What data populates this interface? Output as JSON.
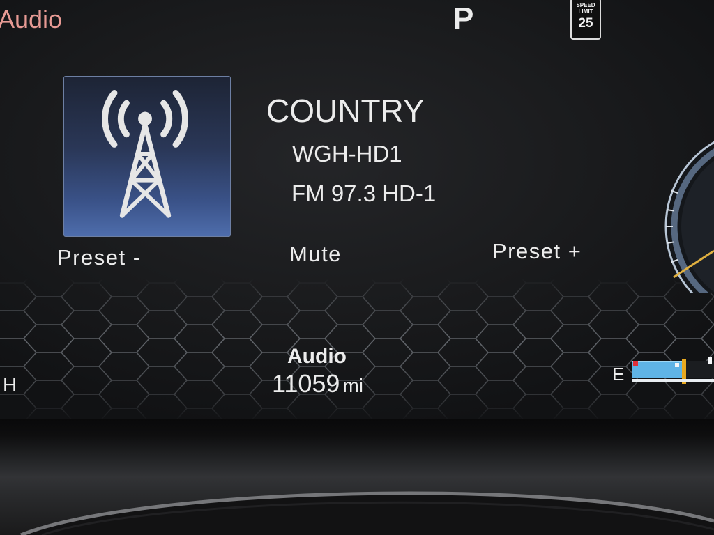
{
  "header": {
    "source_label": "Audio",
    "gear": "P",
    "speed_limit": {
      "line1": "SPEED",
      "line2": "LIMIT",
      "value": "25"
    }
  },
  "now_playing": {
    "icon": "radio-tower-icon",
    "genre": "COUNTRY",
    "station": "WGH-HD1",
    "band_frequency": "FM 97.3 HD-1"
  },
  "controls": [
    {
      "label": "Preset -"
    },
    {
      "label": "Mute"
    },
    {
      "label": "Preset +"
    }
  ],
  "info_panel": {
    "title": "Audio",
    "value": "11059",
    "unit": "mi"
  },
  "temp_gauge": {
    "label": "H"
  },
  "fuel_gauge": {
    "label": "E"
  },
  "icons": {
    "station_art": "radio-tower-icon",
    "speedometer": "speedometer-gauge-icon",
    "fuel": "fuel-level-bar"
  },
  "colors": {
    "text": "#ececec",
    "source": "#e79a94",
    "icon_bg": "#3a5288",
    "fuel": "#5fb4e6",
    "amber": "#e0b040",
    "low": "#e0303a"
  }
}
